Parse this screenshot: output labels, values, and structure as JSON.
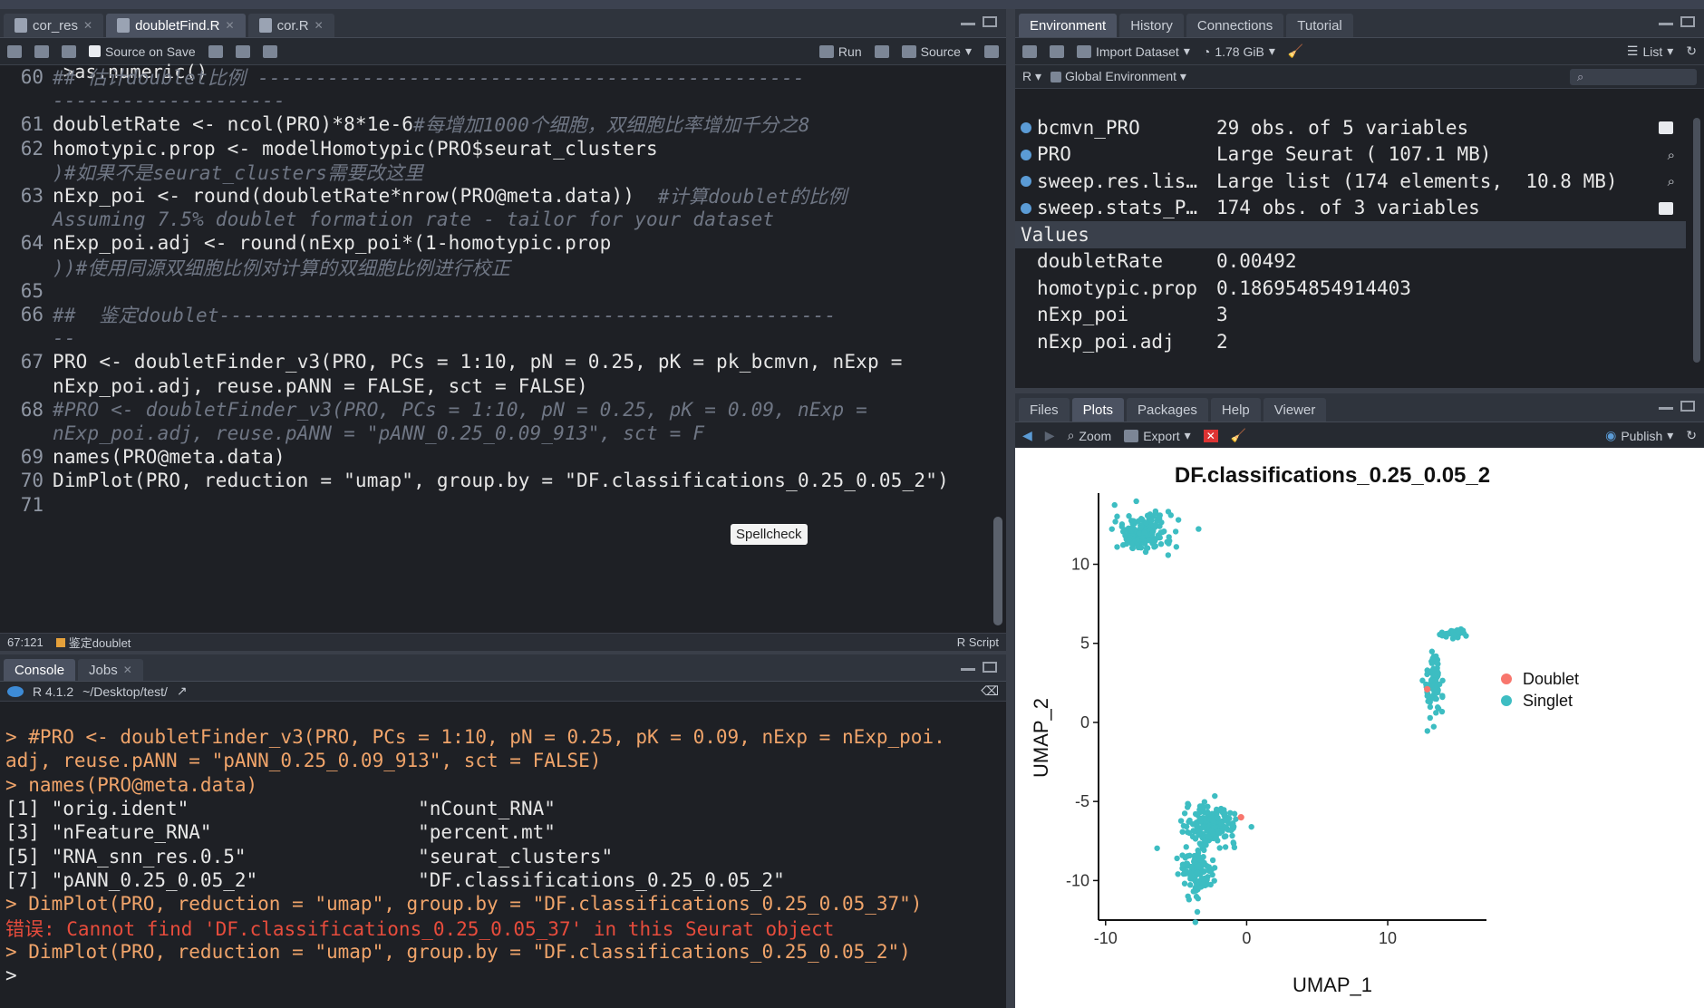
{
  "editor": {
    "tabs": [
      {
        "label": "cor_res"
      },
      {
        "label": "doubletFind.R"
      },
      {
        "label": "cor.R"
      }
    ],
    "toolbar": {
      "source_on_save": "Source on Save",
      "run": "Run",
      "source": "Source"
    },
    "top_partial": ">as.numeric()",
    "lines": [
      {
        "n": "60",
        "code": "## 估计doublet比例 -----------------------------------------------",
        "cls": "cm"
      },
      {
        "n": "",
        "code": "--------------------",
        "cls": "cm"
      },
      {
        "n": "61",
        "code": "doubletRate <- ncol(PRO)*8*1e-6",
        "comment": "#每增加1000个细胞，双细胞比率增加千分之8"
      },
      {
        "n": "62",
        "code": "homotypic.prop <- modelHomotypic(PRO$seurat_clusters"
      },
      {
        "n": "",
        "code": ")#如果不是seurat_clusters需要改这里",
        "cls": "cm"
      },
      {
        "n": "63",
        "code": "nExp_poi <- round(doubletRate*nrow(PRO@meta.data))",
        "comment": "  #计算doublet的比例"
      },
      {
        "n": "",
        "code": "Assuming 7.5% doublet formation rate - tailor for your dataset",
        "cls": "cm"
      },
      {
        "n": "64",
        "code": "nExp_poi.adj <- round(nExp_poi*(1-homotypic.prop"
      },
      {
        "n": "",
        "code": "))#使用同源双细胞比例对计算的双细胞比例进行校正",
        "cls": "cm"
      },
      {
        "n": "65",
        "code": ""
      },
      {
        "n": "66",
        "code": "##  鉴定doublet-----------------------------------------------------",
        "cls": "cm"
      },
      {
        "n": "",
        "code": "--",
        "cls": "cm"
      },
      {
        "n": "67",
        "code": "PRO <- doubletFinder_v3(PRO, PCs = 1:10, pN = 0.25, pK = pk_bcmvn, nExp ="
      },
      {
        "n": "",
        "code": "nExp_poi.adj, reuse.pANN = FALSE, sct = FALSE)"
      },
      {
        "n": "68",
        "code": "#PRO <- doubletFinder_v3(PRO, PCs = 1:10, pN = 0.25, pK = 0.09, nExp =",
        "cls": "cm"
      },
      {
        "n": "",
        "code": "nExp_poi.adj, reuse.pANN = \"pANN_0.25_0.09_913\", sct = F",
        "cls": "cm"
      },
      {
        "n": "69",
        "code": "names(PRO@meta.data)"
      },
      {
        "n": "70",
        "code": "DimPlot(PRO, reduction = \"umap\", group.by = \"DF.classifications_0.25_0.05_2\")"
      },
      {
        "n": "71",
        "code": ""
      }
    ],
    "tooltip": "Spellcheck",
    "status": {
      "position": "67:121",
      "section": "鉴定doublet",
      "type": "R Script"
    }
  },
  "console": {
    "tabs": [
      {
        "label": "Console"
      },
      {
        "label": "Jobs"
      }
    ],
    "version": "R 4.1.2",
    "path": "~/Desktop/test/",
    "lines": [
      {
        "t": "> #PRO <- doubletFinder_v3(PRO, PCs = 1:10, pN = 0.25, pK = 0.09, nExp = nExp_poi.",
        "c": "cmd"
      },
      {
        "t": "adj, reuse.pANN = \"pANN_0.25_0.09_913\", sct = FALSE)",
        "c": "cmd"
      },
      {
        "t": "> names(PRO@meta.data)",
        "c": "cmd"
      },
      {
        "t": "[1] \"orig.ident\"                    \"nCount_RNA\"",
        "c": "out"
      },
      {
        "t": "[3] \"nFeature_RNA\"                  \"percent.mt\"",
        "c": "out"
      },
      {
        "t": "[5] \"RNA_snn_res.0.5\"               \"seurat_clusters\"",
        "c": "out"
      },
      {
        "t": "[7] \"pANN_0.25_0.05_2\"              \"DF.classifications_0.25_0.05_2\"",
        "c": "out"
      },
      {
        "t": "> DimPlot(PRO, reduction = \"umap\", group.by = \"DF.classifications_0.25_0.05_37\")",
        "c": "cmd"
      },
      {
        "t": "错误: Cannot find 'DF.classifications_0.25_0.05_37' in this Seurat object",
        "c": "err"
      },
      {
        "t": "> DimPlot(PRO, reduction = \"umap\", group.by = \"DF.classifications_0.25_0.05_2\")",
        "c": "cmd"
      },
      {
        "t": ">",
        "c": "out"
      }
    ]
  },
  "environment": {
    "tabs": [
      {
        "label": "Environment"
      },
      {
        "label": "History"
      },
      {
        "label": "Connections"
      },
      {
        "label": "Tutorial"
      }
    ],
    "toolbar": {
      "import": "Import Dataset",
      "memory": "1.78 GiB",
      "view": "List"
    },
    "lang": "R",
    "scope": "Global Environment",
    "data": [
      {
        "name": "bcmvn_PRO",
        "value": "29 obs. of 5 variables",
        "icon": "table"
      },
      {
        "name": "PRO",
        "value": "Large Seurat ( 107.1 MB)",
        "icon": "search"
      },
      {
        "name": "sweep.res.lis…",
        "value": "Large list (174 elements,  10.8 MB)",
        "icon": "search"
      },
      {
        "name": "sweep.stats_P…",
        "value": "174 obs. of 3 variables",
        "icon": "table"
      }
    ],
    "values_header": "Values",
    "values": [
      {
        "name": "doubletRate",
        "value": "0.00492"
      },
      {
        "name": "homotypic.prop",
        "value": "0.186954854914403"
      },
      {
        "name": "nExp_poi",
        "value": "3"
      },
      {
        "name": "nExp_poi.adj",
        "value": "2"
      }
    ]
  },
  "plots": {
    "tabs": [
      {
        "label": "Files"
      },
      {
        "label": "Plots"
      },
      {
        "label": "Packages"
      },
      {
        "label": "Help"
      },
      {
        "label": "Viewer"
      }
    ],
    "toolbar": {
      "zoom": "Zoom",
      "export": "Export",
      "publish": "Publish"
    }
  },
  "chart_data": {
    "type": "scatter",
    "title": "DF.classifications_0.25_0.05_2",
    "xlabel": "UMAP_1",
    "ylabel": "UMAP_2",
    "xlim": [
      -10.5,
      17
    ],
    "ylim": [
      -12.5,
      14.5
    ],
    "xticks": [
      -10,
      0,
      10
    ],
    "yticks": [
      -10,
      -5,
      0,
      5,
      10
    ],
    "legend": {
      "position": "right",
      "entries": [
        {
          "name": "Doublet",
          "color": "#f8766d"
        },
        {
          "name": "Singlet",
          "color": "#3dbdc2"
        }
      ]
    },
    "clusters": [
      {
        "series": "Singlet",
        "center": [
          -7.3,
          12
        ],
        "spread": [
          2.0,
          1.2
        ],
        "n": 180
      },
      {
        "series": "Singlet",
        "center": [
          -2.5,
          -6.5
        ],
        "spread": [
          1.8,
          1.2
        ],
        "n": 180
      },
      {
        "series": "Singlet",
        "center": [
          -3.5,
          -9.6
        ],
        "spread": [
          1.2,
          1.5
        ],
        "n": 120
      },
      {
        "series": "Singlet",
        "center": [
          13.2,
          2.6
        ],
        "spread": [
          0.6,
          2.4
        ],
        "n": 80
      },
      {
        "series": "Singlet",
        "center": [
          14.8,
          5.6
        ],
        "spread": [
          0.9,
          0.3
        ],
        "n": 30
      }
    ],
    "doublets": [
      [
        -0.4,
        -6.0
      ],
      [
        12.8,
        2.1
      ]
    ]
  },
  "colors": {
    "accent": "#3dbdc2",
    "doublet": "#f8766d",
    "comment": "#6f7684",
    "number": "#f08c5a",
    "string": "#e5c07b"
  }
}
